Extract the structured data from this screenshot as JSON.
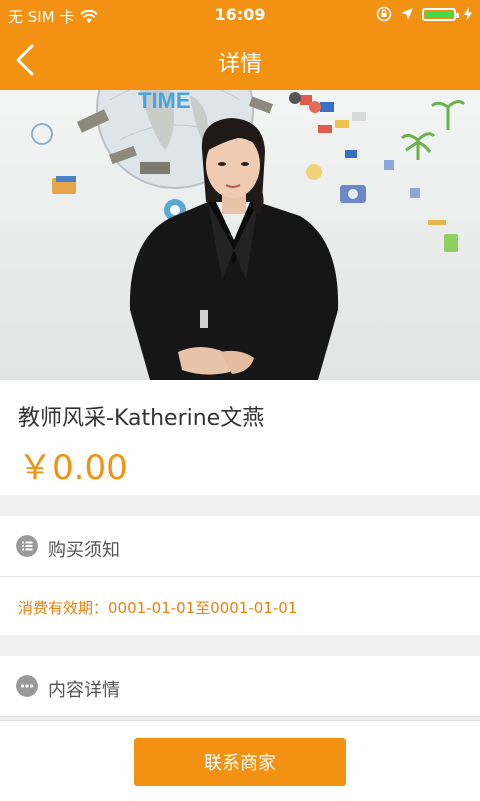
{
  "status_bar": {
    "carrier": "无 SIM 卡",
    "time": "16:09",
    "battery_level": 1.0
  },
  "nav": {
    "title": "详情"
  },
  "hero": {
    "sign_text": "TIME"
  },
  "product": {
    "name": "教师风采-Katherine文燕",
    "price": "￥0.00"
  },
  "purchase_notice": {
    "heading": "购买须知",
    "validity": "消费有效期：0001-01-01至0001-01-01"
  },
  "content_details": {
    "heading": "内容详情"
  },
  "footer": {
    "contact_label": "联系商家"
  },
  "colors": {
    "accent": "#f29112",
    "validity_text": "#e8820c"
  },
  "icons": [
    "wifi-icon",
    "rotation-lock-icon",
    "location-arrow-icon",
    "battery-icon",
    "back-arrow-icon",
    "list-icon",
    "more-dots-icon"
  ]
}
